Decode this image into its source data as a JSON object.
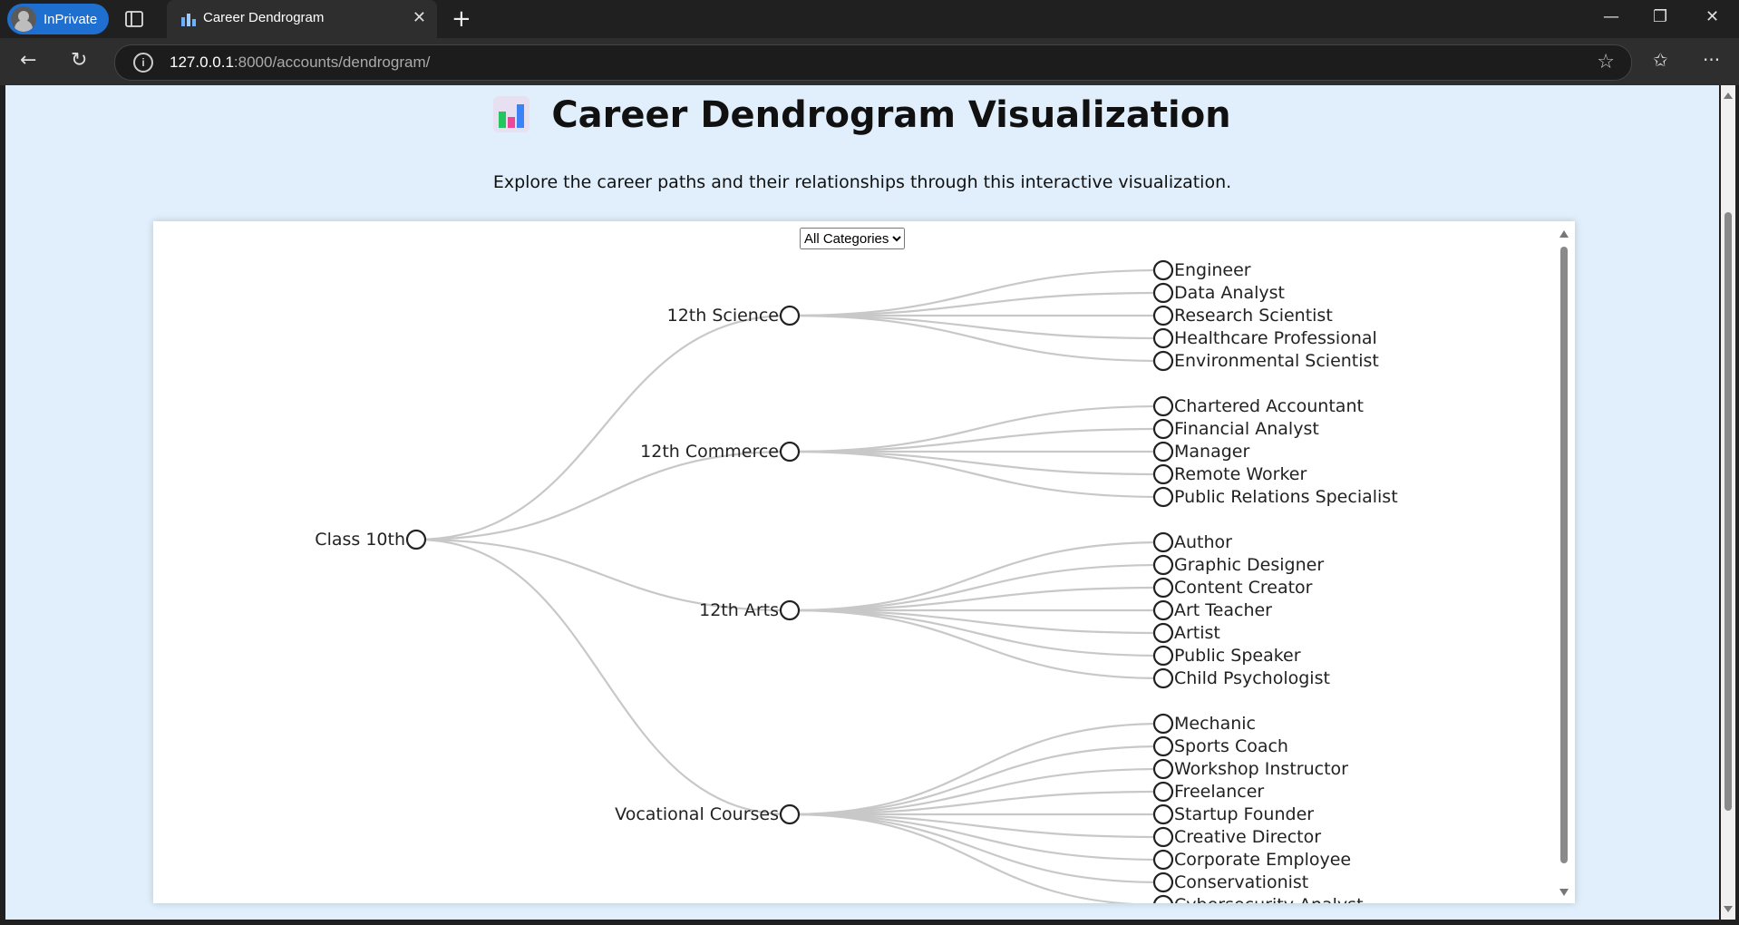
{
  "browser": {
    "inprivate_label": "InPrivate",
    "tab_title": "Career Dendrogram",
    "url_host": "127.0.0.1",
    "url_rest": ":8000/accounts/dendrogram/"
  },
  "page": {
    "title": "Career Dendrogram Visualization",
    "subtitle": "Explore the career paths and their relationships through this interactive visualization.",
    "category_select": {
      "selected": "All Categories"
    }
  },
  "tree": {
    "root": "Class 10th",
    "branches": [
      {
        "name": "12th Science",
        "leaves": [
          "Engineer",
          "Data Analyst",
          "Research Scientist",
          "Healthcare Professional",
          "Environmental Scientist"
        ]
      },
      {
        "name": "12th Commerce",
        "leaves": [
          "Chartered Accountant",
          "Financial Analyst",
          "Manager",
          "Remote Worker",
          "Public Relations Specialist"
        ]
      },
      {
        "name": "12th Arts",
        "leaves": [
          "Author",
          "Graphic Designer",
          "Content Creator",
          "Art Teacher",
          "Artist",
          "Public Speaker",
          "Child Psychologist"
        ]
      },
      {
        "name": "Vocational Courses",
        "leaves": [
          "Mechanic",
          "Sports Coach",
          "Workshop Instructor",
          "Freelancer",
          "Startup Founder",
          "Creative Director",
          "Corporate Employee",
          "Conservationist",
          "Cybersecurity Analyst"
        ]
      }
    ]
  },
  "colors": {
    "link": "#c8c8c8",
    "node_stroke": "#222222",
    "panel_bg": "#ffffff",
    "page_bg": "#e0effb"
  }
}
